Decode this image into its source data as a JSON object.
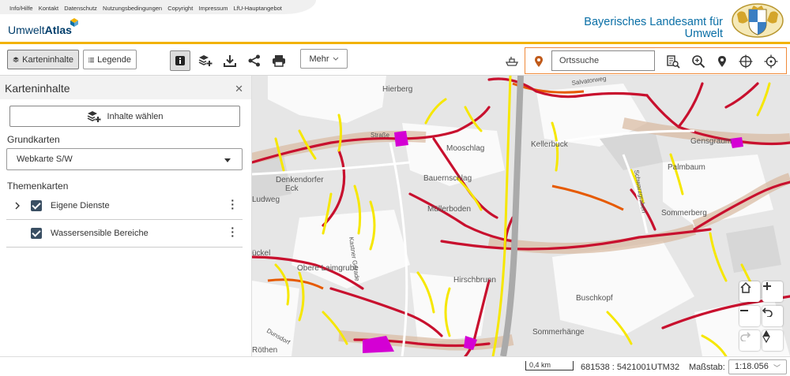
{
  "header": {
    "links": [
      "Info/Hilfe",
      "Kontakt",
      "Datenschutz",
      "Nutzungsbedingungen",
      "Copyright",
      "Impressum",
      "LfU-Hauptangebot"
    ],
    "logo_prefix": "Umwelt",
    "logo_suffix": "Atlas",
    "org_line1": "Bayerisches Landesamt für",
    "org_line2": "Umwelt",
    "accent_color": "#f2b200",
    "brand_color": "#0a6fa6"
  },
  "toolbar": {
    "contents_label": "Karteninhalte",
    "legend_label": "Legende",
    "more_label": "Mehr",
    "icons": [
      "info-icon",
      "add-layers-icon",
      "download-icon",
      "share-icon",
      "print-icon"
    ],
    "search_placeholder": "Ortssuche",
    "search_tools": [
      "address-search-icon",
      "zoom-search-icon",
      "map-marker-icon",
      "crosshair-icon",
      "locate-icon"
    ]
  },
  "sidepanel": {
    "title": "Karteninhalte",
    "add_button_label": "Inhalte wählen",
    "basemaps_heading": "Grundkarten",
    "basemap_selected": "Webkarte S/W",
    "themes_heading": "Themenkarten",
    "layers": [
      {
        "label": "Eigene Dienste",
        "checked": true,
        "expandable": true
      },
      {
        "label": "Wassersensible Bereiche",
        "checked": true,
        "expandable": false
      }
    ]
  },
  "map": {
    "place_names": [
      "Hierberg",
      "Salvatorweg",
      "Straße",
      "Mooschlag",
      "Kellerbuck",
      "Denkendorfer",
      "Eck",
      "Bauernschlag",
      "Palmbaum",
      "Müllerboden",
      "Sommerberg",
      "Schwarzgraben",
      "Ludweg",
      "Obere Laimgrube",
      "Kastner Gerade",
      "Hirschbrunn",
      "Buschkopf",
      "Sommerhänge",
      "Röthen",
      "Gensgraum",
      "ückel",
      "dorfer",
      "Dunsdorf"
    ],
    "controls": [
      "home-icon",
      "zoom-in-icon",
      "zoom-out-icon",
      "undo-icon",
      "redo-icon",
      "north-arrow-icon"
    ]
  },
  "statusbar": {
    "scalebar_label": "0,4 km",
    "coordinates": "681538 : 5421001",
    "crs": "UTM32",
    "scale_label": "Maßstab:",
    "scale_value": "1:18.056"
  }
}
